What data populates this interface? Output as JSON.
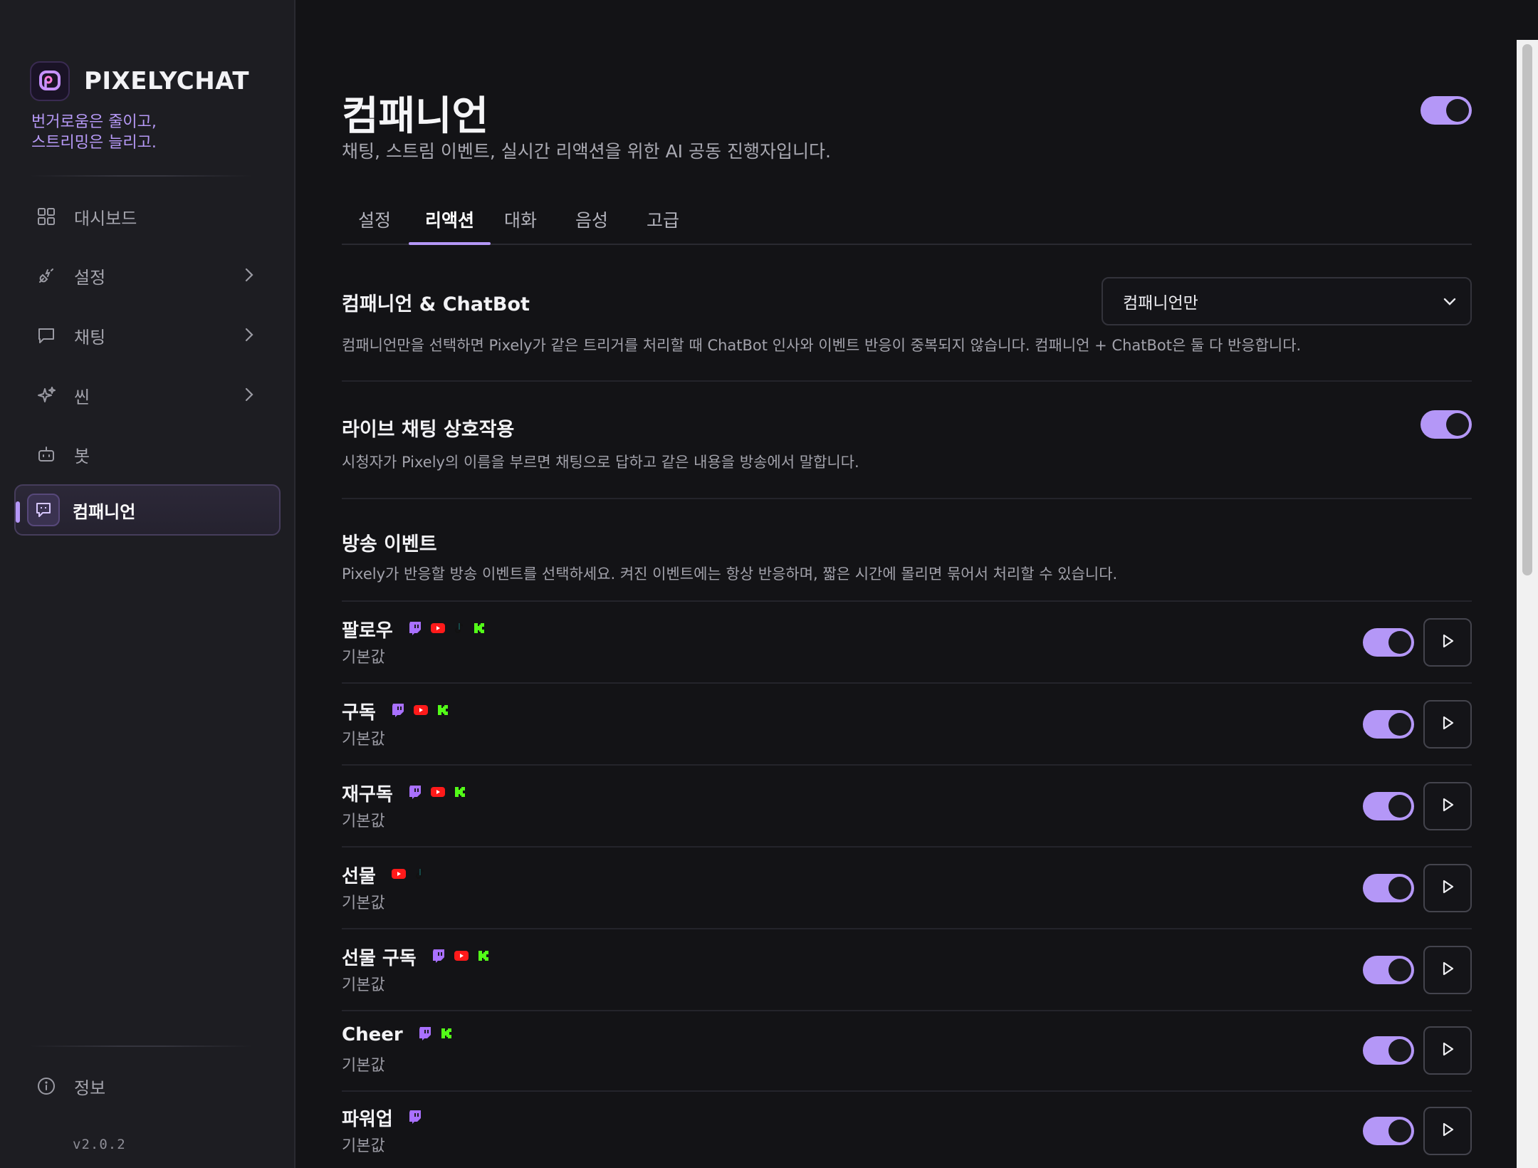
{
  "app": {
    "brand_name": "PIXELYCHAT",
    "tagline": "번거로움은 줄이고,\n스트리밍은 늘리고.",
    "version": "v2.0.2",
    "accent_color": "#b497f7"
  },
  "sidebar": {
    "items": [
      {
        "label": "대시보드",
        "icon": "dashboard-grid-icon"
      },
      {
        "label": "설정",
        "icon": "plug-icon"
      },
      {
        "label": "채팅",
        "icon": "chat-bubble-icon"
      },
      {
        "label": "씬",
        "icon": "sparkles-icon"
      },
      {
        "label": "봇",
        "icon": "robot-icon"
      },
      {
        "label": "컴패니언",
        "icon": "companion-icon"
      }
    ],
    "footer_item": {
      "label": "정보",
      "icon": "info-icon"
    }
  },
  "page": {
    "title": "컴패니언",
    "subtitle": "채팅, 스트림 이벤트, 실시간 리액션을 위한 AI 공동 진행자입니다."
  },
  "tabs": [
    {
      "label": "설정"
    },
    {
      "label": "리액션"
    },
    {
      "label": "대화"
    },
    {
      "label": "음성"
    },
    {
      "label": "고급"
    }
  ],
  "sections": {
    "chatbot": {
      "title": "컴패니언 & ChatBot",
      "select_value": "컴패니언만",
      "desc": "컴패니언만을 선택하면 Pixely가 같은 트리거를 처리할 때 ChatBot 인사와 이벤트 반응이 중복되지 않습니다. 컴패니언 + ChatBot은 둘 다 반응합니다."
    },
    "live_chat": {
      "title": "라이브 채팅 상호작용",
      "desc": "시청자가 Pixely의 이름을 부르면 채팅으로 답하고 같은 내용을 방송에서 말합니다."
    },
    "events": {
      "title": "방송 이벤트",
      "desc": "Pixely가 반응할 방송 이벤트를 선택하세요. 켜진 이벤트에는 항상 반응하며, 짧은 시간에 몰리면 묶어서 처리할 수 있습니다.",
      "items": [
        {
          "name": "팔로우",
          "sub": "기본값",
          "platforms": [
            "twitch-icon",
            "youtube-icon",
            "tiktok-icon",
            "kick-icon"
          ]
        },
        {
          "name": "구독",
          "sub": "기본값",
          "platforms": [
            "twitch-icon",
            "youtube-icon",
            "kick-icon"
          ]
        },
        {
          "name": "재구독",
          "sub": "기본값",
          "platforms": [
            "twitch-icon",
            "youtube-icon",
            "kick-icon"
          ]
        },
        {
          "name": "선물",
          "sub": "기본값",
          "platforms": [
            "youtube-icon",
            "tiktok-icon"
          ]
        },
        {
          "name": "선물 구독",
          "sub": "기본값",
          "platforms": [
            "twitch-icon",
            "youtube-icon",
            "kick-icon"
          ]
        },
        {
          "name": "Cheer",
          "sub": "기본값",
          "platforms": [
            "twitch-icon",
            "kick-icon"
          ]
        },
        {
          "name": "파워업",
          "sub": "기본값",
          "platforms": [
            "twitch-icon"
          ]
        }
      ]
    }
  }
}
